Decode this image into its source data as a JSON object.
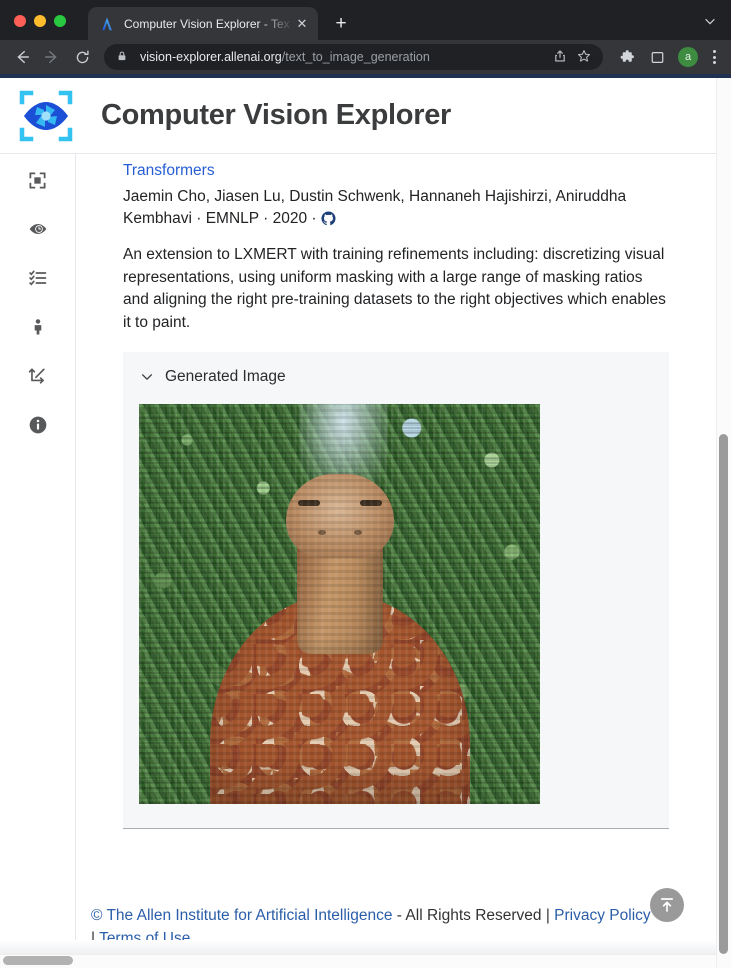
{
  "browser": {
    "tab": {
      "title": "Computer Vision Explorer - Tex",
      "favicon_name": "ai2-favicon",
      "close_label": "✕"
    },
    "new_tab_label": "+",
    "tabstrip_menu_icon": "chevron-down-icon",
    "toolbar": {
      "back_icon": "back-arrow-icon",
      "forward_icon": "forward-arrow-icon",
      "reload_icon": "reload-icon",
      "lock_icon": "lock-icon",
      "url_domain": "vision-explorer.allenai.org",
      "url_path": "/text_to_image_generation",
      "share_icon": "share-icon",
      "bookmark_icon": "star-icon",
      "extensions_icon": "puzzle-icon",
      "sidepanel_icon": "side-panel-icon",
      "avatar_letter": "a",
      "menu_icon": "kebab-menu-icon"
    }
  },
  "header": {
    "title": "Computer Vision Explorer",
    "logo_name": "cv-explorer-eye-logo"
  },
  "sidebar": {
    "items": [
      {
        "name": "sidebar-item-detection",
        "icon": "crop-frame-icon"
      },
      {
        "name": "sidebar-item-visual-qa",
        "icon": "eye-clock-icon"
      },
      {
        "name": "sidebar-item-checklist",
        "icon": "checklist-icon"
      },
      {
        "name": "sidebar-item-person",
        "icon": "person-icon"
      },
      {
        "name": "sidebar-item-transform",
        "icon": "transform-arrows-icon"
      },
      {
        "name": "sidebar-item-info",
        "icon": "info-circle-icon"
      }
    ]
  },
  "main": {
    "paper": {
      "venue_link": "Transformers",
      "authors": "Jaemin Cho, Jiasen Lu, Dustin Schwenk, Hannaneh Hajishirzi, Aniruddha Kembhavi",
      "separator": " · ",
      "conference": "EMNLP",
      "year": "2020",
      "code_icon": "github-icon",
      "abstract": "An extension to LXMERT with training refinements including: discretizing visual representations, using uniform masking with a large range of masking ratios and aligning the right pre-training datasets to the right objectives which enables it to paint."
    },
    "generated_image_panel": {
      "collapse_icon": "chevron-down-icon",
      "title": "Generated Image",
      "image_alt": "generated-giraffe-in-forest"
    },
    "scroll_to_top": {
      "icon": "arrow-to-top-icon",
      "label": "⤒"
    }
  },
  "footer": {
    "copyright_link": "© The Allen Institute for Artificial Intelligence",
    "rights": " - All Rights Reserved | ",
    "privacy_link": "Privacy Policy",
    "divider": " | ",
    "terms_link": "Terms of Use"
  },
  "colors": {
    "brand_blue": "#265ed4",
    "link_blue": "#2b5ea8",
    "chrome_dark": "#202124",
    "chrome_toolbar": "#35363a",
    "accent_underline": "#1f3050",
    "avatar_green": "#3d8c40"
  }
}
